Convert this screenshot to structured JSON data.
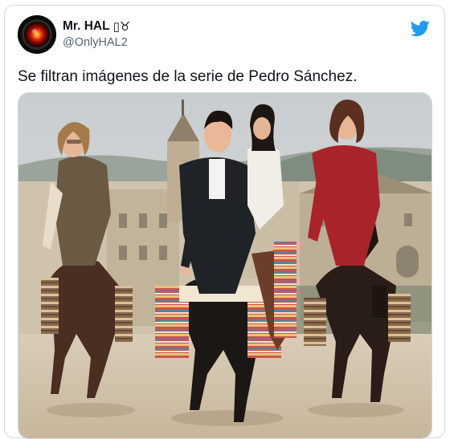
{
  "tweet": {
    "display_name": "Mr. HAL",
    "name_symbols": "▯♉",
    "handle": "@OnlyHAL2",
    "text": "Se filtran imágenes de la serie de Pedro Sánchez.",
    "avatar_icon": "hal-9000-eye-icon",
    "brand_icon": "twitter-bird-icon",
    "brand_color": "#1d9bf0"
  },
  "media": {
    "description_icon": "photo"
  }
}
